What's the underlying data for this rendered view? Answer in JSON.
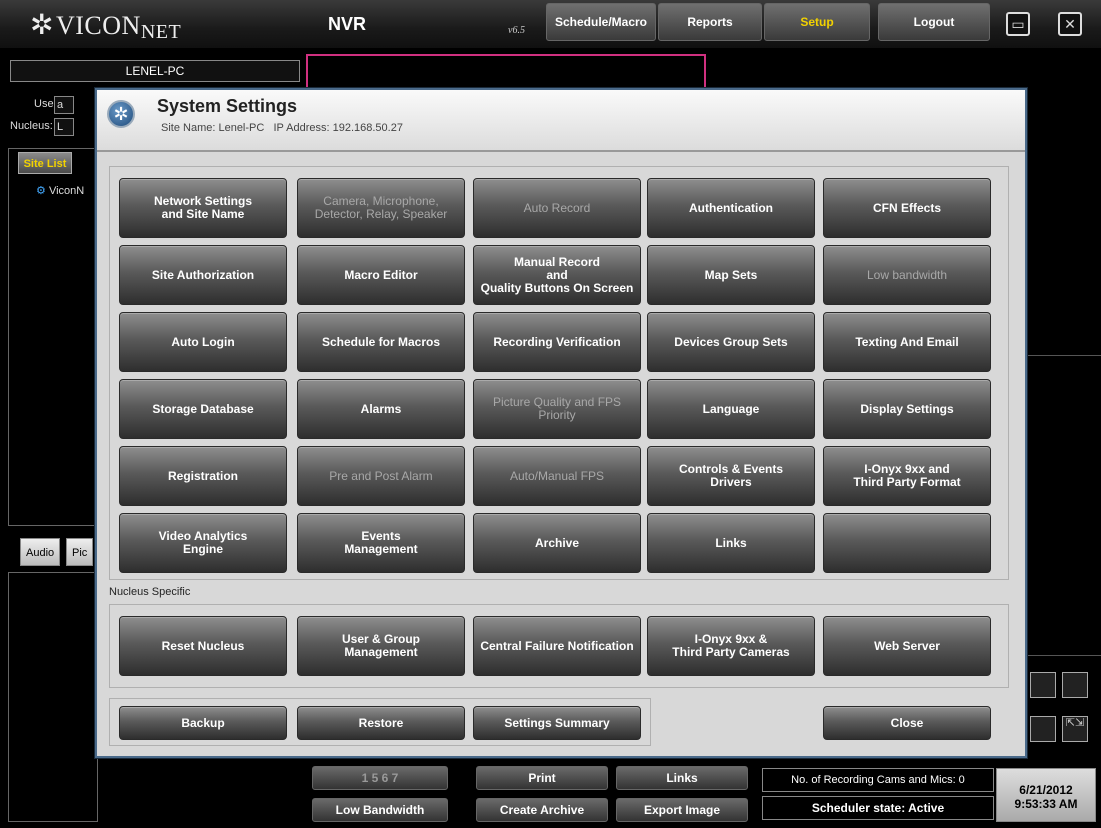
{
  "topbar": {
    "logo_text": "VICON",
    "logo_sub": "NET",
    "app_name": "NVR",
    "version": "v6.5",
    "buttons": [
      {
        "label": "Schedule/Macro"
      },
      {
        "label": "Reports"
      },
      {
        "label": "Setup",
        "active": true
      },
      {
        "label": "Logout"
      }
    ],
    "minimize_icon": "minimize-icon",
    "close_icon": "close-icon"
  },
  "background": {
    "site_name": "LENEL-PC",
    "user_label": "User:",
    "user_value": "a",
    "nucleus_label": "Nucleus:",
    "nucleus_value": "L",
    "site_list_tab": "Site List",
    "tree_item": "ViconN",
    "audio_tab": "Audio",
    "pic_tab": "Pic"
  },
  "dialog": {
    "title": "System Settings",
    "subtitle": "Site Name: Lenel-PC   IP Address: 192.168.50.27",
    "grid": [
      [
        {
          "label": "Network Settings\nand Site Name",
          "enabled": true
        },
        {
          "label": "Camera,  Microphone,\nDetector, Relay, Speaker",
          "enabled": false
        },
        {
          "label": "Auto Record",
          "enabled": false
        },
        {
          "label": "Authentication",
          "enabled": true
        },
        {
          "label": "CFN Effects",
          "enabled": true
        }
      ],
      [
        {
          "label": "Site Authorization",
          "enabled": true
        },
        {
          "label": "Macro Editor",
          "enabled": true
        },
        {
          "label": "Manual Record\nand\nQuality Buttons On Screen",
          "enabled": true
        },
        {
          "label": "Map Sets",
          "enabled": true
        },
        {
          "label": "Low bandwidth",
          "enabled": false
        }
      ],
      [
        {
          "label": "Auto Login",
          "enabled": true
        },
        {
          "label": "Schedule for Macros",
          "enabled": true
        },
        {
          "label": "Recording Verification",
          "enabled": true
        },
        {
          "label": "Devices Group Sets",
          "enabled": true
        },
        {
          "label": "Texting And Email",
          "enabled": true
        }
      ],
      [
        {
          "label": "Storage Database",
          "enabled": true
        },
        {
          "label": "Alarms",
          "enabled": true
        },
        {
          "label": "Picture Quality and FPS\nPriority",
          "enabled": false
        },
        {
          "label": "Language",
          "enabled": true
        },
        {
          "label": "Display Settings",
          "enabled": true
        }
      ],
      [
        {
          "label": "Registration",
          "enabled": true
        },
        {
          "label": "Pre and Post Alarm",
          "enabled": false
        },
        {
          "label": "Auto/Manual FPS",
          "enabled": false
        },
        {
          "label": "Controls & Events\nDrivers",
          "enabled": true
        },
        {
          "label": "I-Onyx 9xx and\nThird Party Format",
          "enabled": true
        }
      ],
      [
        {
          "label": "Video Analytics\nEngine",
          "enabled": true
        },
        {
          "label": "Events\nManagement",
          "enabled": true
        },
        {
          "label": "Archive",
          "enabled": true
        },
        {
          "label": "Links",
          "enabled": true
        },
        {
          "label": "",
          "enabled": true
        }
      ]
    ],
    "nucleus_label": "Nucleus Specific",
    "nucleus_buttons": [
      {
        "label": "Reset Nucleus",
        "enabled": true
      },
      {
        "label": "User & Group\nManagement",
        "enabled": true
      },
      {
        "label": "Central Failure Notification",
        "enabled": true
      },
      {
        "label": "I-Onyx 9xx &\nThird Party Cameras",
        "enabled": true
      },
      {
        "label": "Web Server",
        "enabled": true
      }
    ],
    "footer_buttons": [
      {
        "label": "Backup"
      },
      {
        "label": "Restore"
      },
      {
        "label": "Settings Summary"
      }
    ],
    "close_label": "Close"
  },
  "bottom": {
    "page_numbers": "1    5    6    7",
    "low_bandwidth": "Low Bandwidth",
    "print": "Print",
    "create_archive": "Create Archive",
    "links": "Links",
    "export_image": "Export Image",
    "recording_cams": "No. of Recording Cams and Mics: 0",
    "scheduler_state": "Scheduler state: Active",
    "date": "6/21/2012",
    "time": "9:53:33 AM"
  }
}
